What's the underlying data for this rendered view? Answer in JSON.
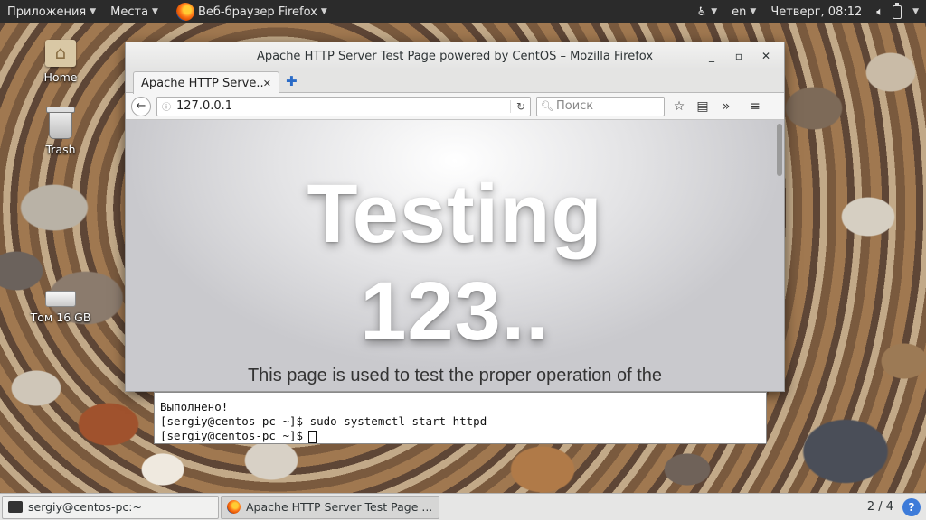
{
  "top_panel": {
    "applications": "Приложения",
    "places": "Места",
    "active_app": "Веб-браузер Firefox",
    "language": "en",
    "clock": "Четверг, 08:12"
  },
  "desktop": {
    "icons": [
      {
        "label": "Home"
      },
      {
        "label": "Trash"
      },
      {
        "label": "Том 16 GB"
      }
    ]
  },
  "firefox": {
    "window_title": "Apache HTTP Server Test Page powered by CentOS – Mozilla Firefox",
    "tab_title": "Apache HTTP Serve...",
    "url": "127.0.0.1",
    "search_placeholder": "Поиск",
    "page": {
      "headline_1": "Testing",
      "headline_2": "123..",
      "subtext": "This page is used to test the proper operation of the"
    }
  },
  "terminal": {
    "lines": [
      "Выполнено!",
      "[sergiy@centos-pc ~]$ sudo systemctl start httpd",
      "[sergiy@centos-pc ~]$"
    ]
  },
  "taskbar": {
    "items": [
      {
        "label": "sergiy@centos-pc:~"
      },
      {
        "label": "Apache HTTP Server Test Page ..."
      }
    ],
    "workspace": "2 / 4",
    "notify": "?"
  }
}
